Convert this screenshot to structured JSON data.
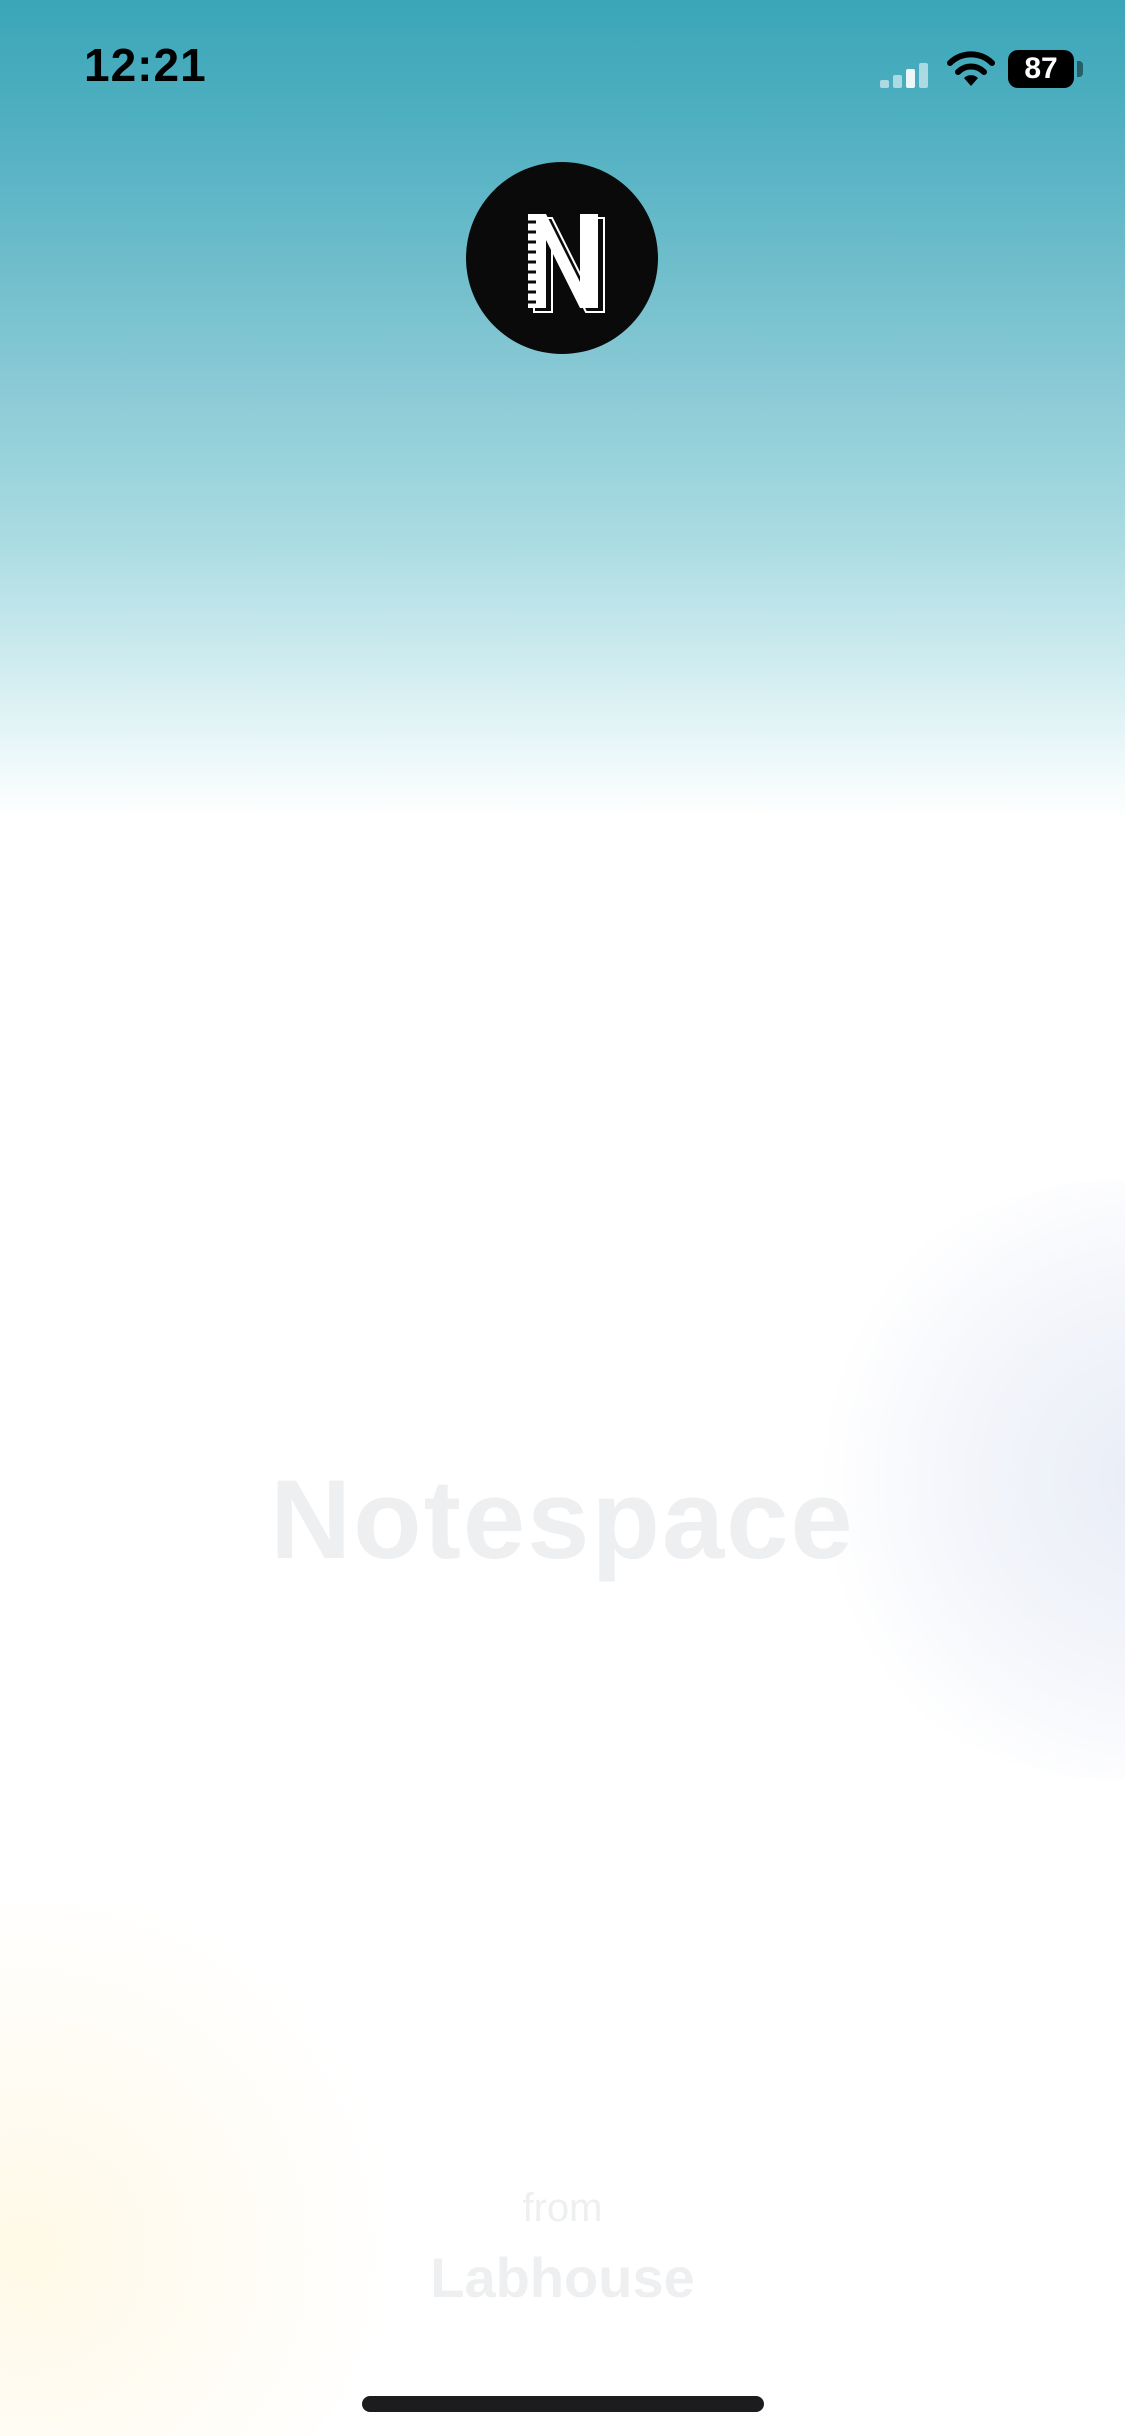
{
  "status_bar": {
    "time": "12:21",
    "battery_level": "87",
    "signal_icon": "cellular-signal-icon",
    "wifi_icon": "wifi-icon"
  },
  "splash": {
    "logo_icon": "notespace-logo-icon",
    "logo_letter": "N",
    "app_name": "Notespace",
    "from_label": "from",
    "company_name": "Labhouse"
  },
  "colors": {
    "top_gradient": "#39a6b8",
    "title_text": "#eeeff1",
    "logo_background": "#0a0a0a",
    "home_indicator": "#1c1c1e"
  }
}
